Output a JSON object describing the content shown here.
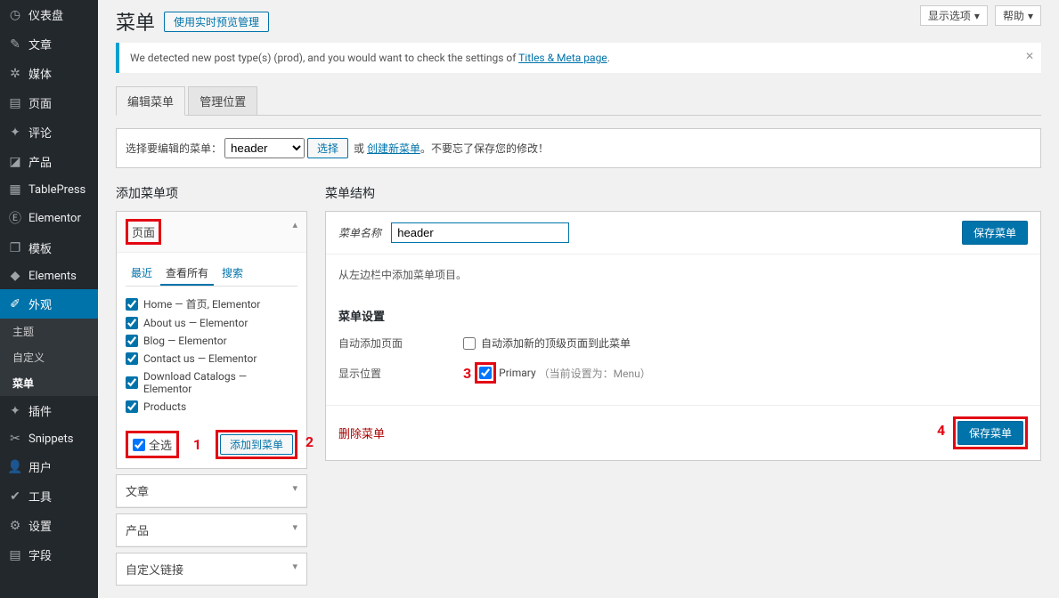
{
  "sidebar": {
    "items": [
      {
        "icon": "◷",
        "label": "仪表盘"
      },
      {
        "icon": "✎",
        "label": "文章"
      },
      {
        "icon": "✲",
        "label": "媒体"
      },
      {
        "icon": "▤",
        "label": "页面"
      },
      {
        "icon": "✦",
        "label": "评论"
      },
      {
        "icon": "◪",
        "label": "产品"
      },
      {
        "icon": "▦",
        "label": "TablePress"
      },
      {
        "icon": "Ⓔ",
        "label": "Elementor"
      },
      {
        "icon": "❐",
        "label": "模板"
      },
      {
        "icon": "◆",
        "label": "Elements"
      },
      {
        "icon": "✐",
        "label": "外观"
      }
    ],
    "subitems": [
      "主题",
      "自定义",
      "菜单"
    ],
    "items2": [
      {
        "icon": "✦",
        "label": "插件"
      },
      {
        "icon": "✂",
        "label": "Snippets"
      },
      {
        "icon": "👤",
        "label": "用户"
      },
      {
        "icon": "✔",
        "label": "工具"
      },
      {
        "icon": "⚙",
        "label": "设置"
      },
      {
        "icon": "▤",
        "label": "字段"
      }
    ]
  },
  "top": {
    "title": "菜单",
    "live_btn": "使用实时预览管理",
    "screen_options": "显示选项",
    "help": "帮助"
  },
  "notice": {
    "prefix": "We detected new post type(s) (prod), and you would want to check the settings of ",
    "link": "Titles & Meta page",
    "suffix": "."
  },
  "tabs": {
    "edit": "编辑菜单",
    "locations": "管理位置"
  },
  "selector": {
    "label": "选择要编辑的菜单：",
    "value": "header",
    "select_btn": "选择",
    "or": "或",
    "create_link": "创建新菜单",
    "tail": "。不要忘了保存您的修改！"
  },
  "left": {
    "title": "添加菜单项",
    "pages_label": "页面",
    "tabs": {
      "recent": "最近",
      "all": "查看所有",
      "search": "搜索"
    },
    "items": [
      "Home — 首页, Elementor",
      "About us — Elementor",
      "Blog — Elementor",
      "Contact us — Elementor",
      "Download Catalogs — Elementor",
      "Products"
    ],
    "select_all": "全选",
    "add_btn": "添加到菜单",
    "acc_posts": "文章",
    "acc_products": "产品",
    "acc_custom": "自定义链接"
  },
  "right": {
    "title": "菜单结构",
    "name_label": "菜单名称",
    "name_value": "header",
    "save_btn": "保存菜单",
    "help_text": "从左边栏中添加菜单项目。",
    "settings_title": "菜单设置",
    "auto_add_label": "自动添加页面",
    "auto_add_check": "自动添加新的顶级页面到此菜单",
    "display_label": "显示位置",
    "primary": "Primary",
    "current_hint": "（当前设置为：Menu）",
    "delete": "删除菜单"
  },
  "nums": {
    "n1": "1",
    "n2": "2",
    "n3": "3",
    "n4": "4"
  }
}
